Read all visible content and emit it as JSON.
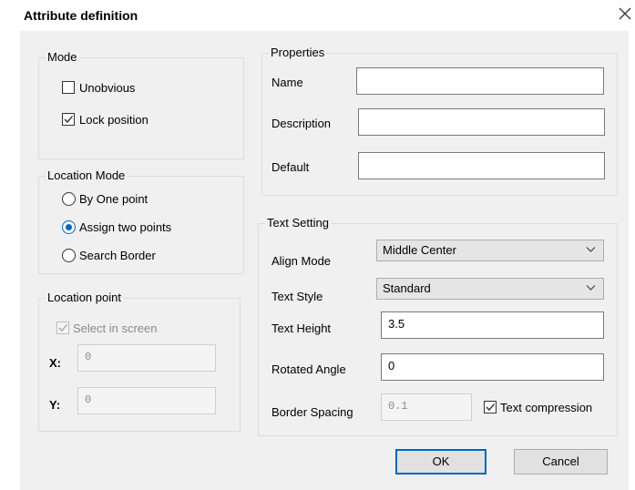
{
  "title": "Attribute definition",
  "mode": {
    "label": "Mode",
    "unobvious": {
      "label": "Unobvious",
      "checked": false
    },
    "lock_position": {
      "label": "Lock position",
      "checked": true
    }
  },
  "location_mode": {
    "label": "Location Mode",
    "options": [
      {
        "label": "By One point",
        "selected": false
      },
      {
        "label": "Assign two points",
        "selected": true
      },
      {
        "label": "Search Border",
        "selected": false
      }
    ]
  },
  "location_point": {
    "label": "Location point",
    "select_in_screen": {
      "label": "Select in screen",
      "checked": true,
      "enabled": false
    },
    "x": {
      "label": "X:",
      "placeholder": "0"
    },
    "y": {
      "label": "Y:",
      "placeholder": "0"
    }
  },
  "properties": {
    "label": "Properties",
    "name": {
      "label": "Name",
      "value": ""
    },
    "description": {
      "label": "Description",
      "value": ""
    },
    "default": {
      "label": "Default",
      "value": ""
    }
  },
  "text_setting": {
    "label": "Text Setting",
    "align_mode": {
      "label": "Align Mode",
      "value": "Middle Center"
    },
    "text_style": {
      "label": "Text Style",
      "value": "Standard"
    },
    "text_height": {
      "label": "Text Height",
      "value": "3.5"
    },
    "rotated_angle": {
      "label": "Rotated Angle",
      "value": "0"
    },
    "border_spacing": {
      "label": "Border Spacing",
      "value": "0.1"
    },
    "text_compression": {
      "label": "Text compression",
      "checked": true
    }
  },
  "buttons": {
    "ok": "OK",
    "cancel": "Cancel"
  },
  "colors": {
    "accent": "#0067c0",
    "dialog_bg": "#f0f0f0"
  }
}
